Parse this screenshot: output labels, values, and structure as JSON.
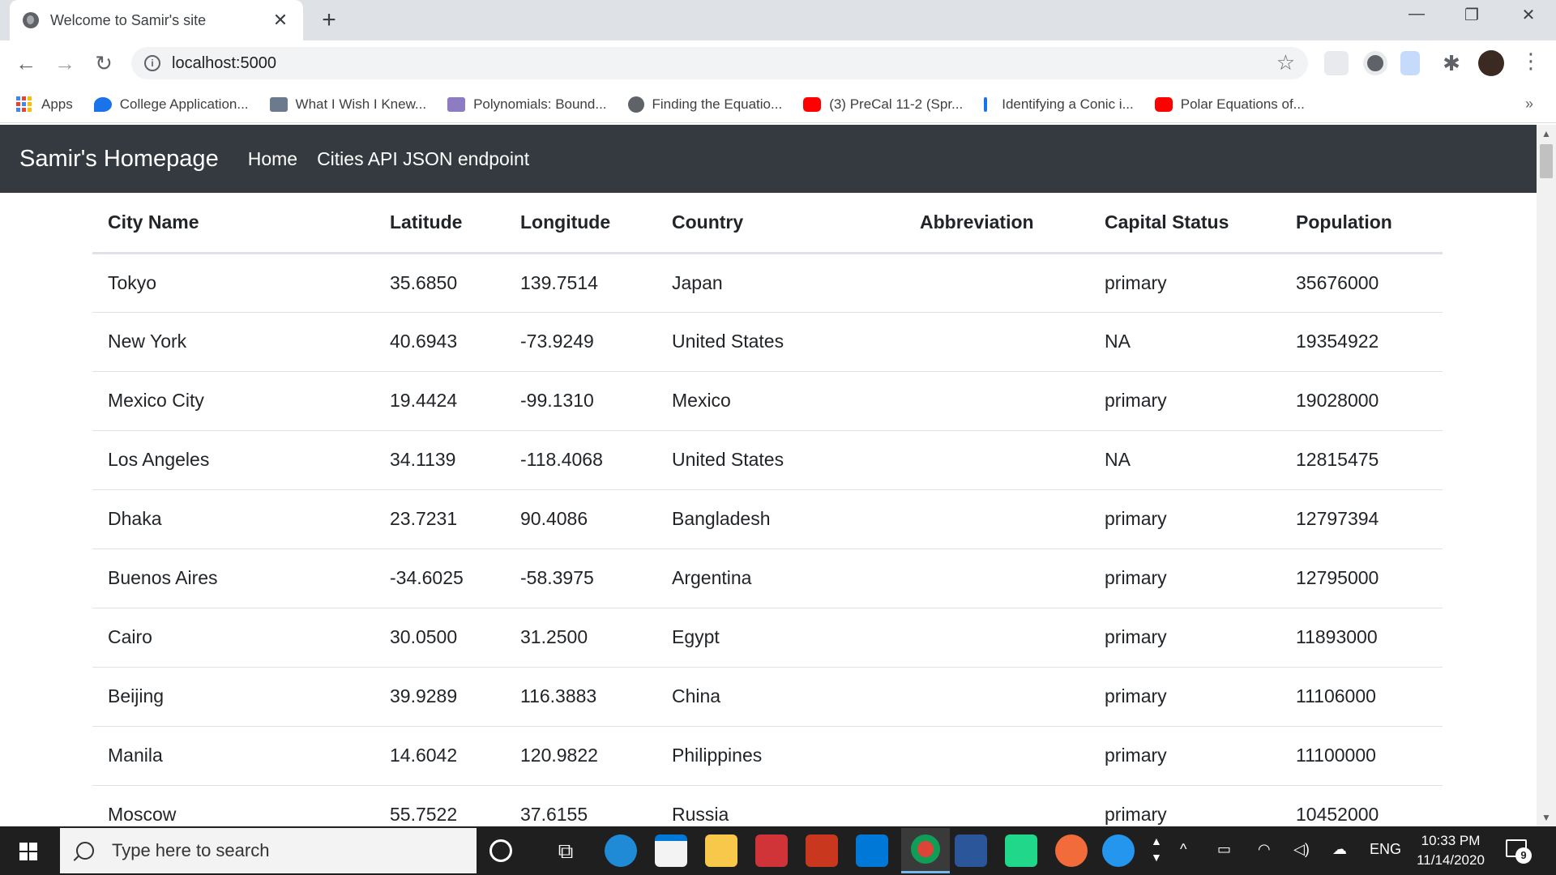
{
  "browser": {
    "tab_title": "Welcome to Samir's site",
    "url": "localhost:5000",
    "bookmarks": [
      {
        "label": "Apps"
      },
      {
        "label": "College Application..."
      },
      {
        "label": "What I Wish I Knew..."
      },
      {
        "label": "Polynomials: Bound..."
      },
      {
        "label": "Finding the Equatio..."
      },
      {
        "label": "(3) PreCal 11-2 (Spr..."
      },
      {
        "label": "Identifying a Conic i..."
      },
      {
        "label": "Polar Equations of..."
      }
    ]
  },
  "site": {
    "brand": "Samir's Homepage",
    "nav": [
      "Home",
      "Cities API JSON endpoint"
    ]
  },
  "table": {
    "headers": [
      "City Name",
      "Latitude",
      "Longitude",
      "Country",
      "Abbreviation",
      "Capital Status",
      "Population"
    ],
    "rows": [
      [
        "Tokyo",
        "35.6850",
        "139.7514",
        "Japan",
        "",
        "primary",
        "35676000"
      ],
      [
        "New York",
        "40.6943",
        "-73.9249",
        "United States",
        "",
        "NA",
        "19354922"
      ],
      [
        "Mexico City",
        "19.4424",
        "-99.1310",
        "Mexico",
        "",
        "primary",
        "19028000"
      ],
      [
        "Los Angeles",
        "34.1139",
        "-118.4068",
        "United States",
        "",
        "NA",
        "12815475"
      ],
      [
        "Dhaka",
        "23.7231",
        "90.4086",
        "Bangladesh",
        "",
        "primary",
        "12797394"
      ],
      [
        "Buenos Aires",
        "-34.6025",
        "-58.3975",
        "Argentina",
        "",
        "primary",
        "12795000"
      ],
      [
        "Cairo",
        "30.0500",
        "31.2500",
        "Egypt",
        "",
        "primary",
        "11893000"
      ],
      [
        "Beijing",
        "39.9289",
        "116.3883",
        "China",
        "",
        "primary",
        "11106000"
      ],
      [
        "Manila",
        "14.6042",
        "120.9822",
        "Philippines",
        "",
        "primary",
        "11100000"
      ],
      [
        "Moscow",
        "55.7522",
        "37.6155",
        "Russia",
        "",
        "primary",
        "10452000"
      ]
    ]
  },
  "taskbar": {
    "search_placeholder": "Type here to search",
    "language": "ENG",
    "time": "10:33 PM",
    "date": "11/14/2020",
    "notification_count": "9"
  },
  "colors": {
    "navbar_bg": "#343a40",
    "tabstrip_bg": "#dee1e6",
    "taskbar_bg": "#1f1f1f"
  }
}
